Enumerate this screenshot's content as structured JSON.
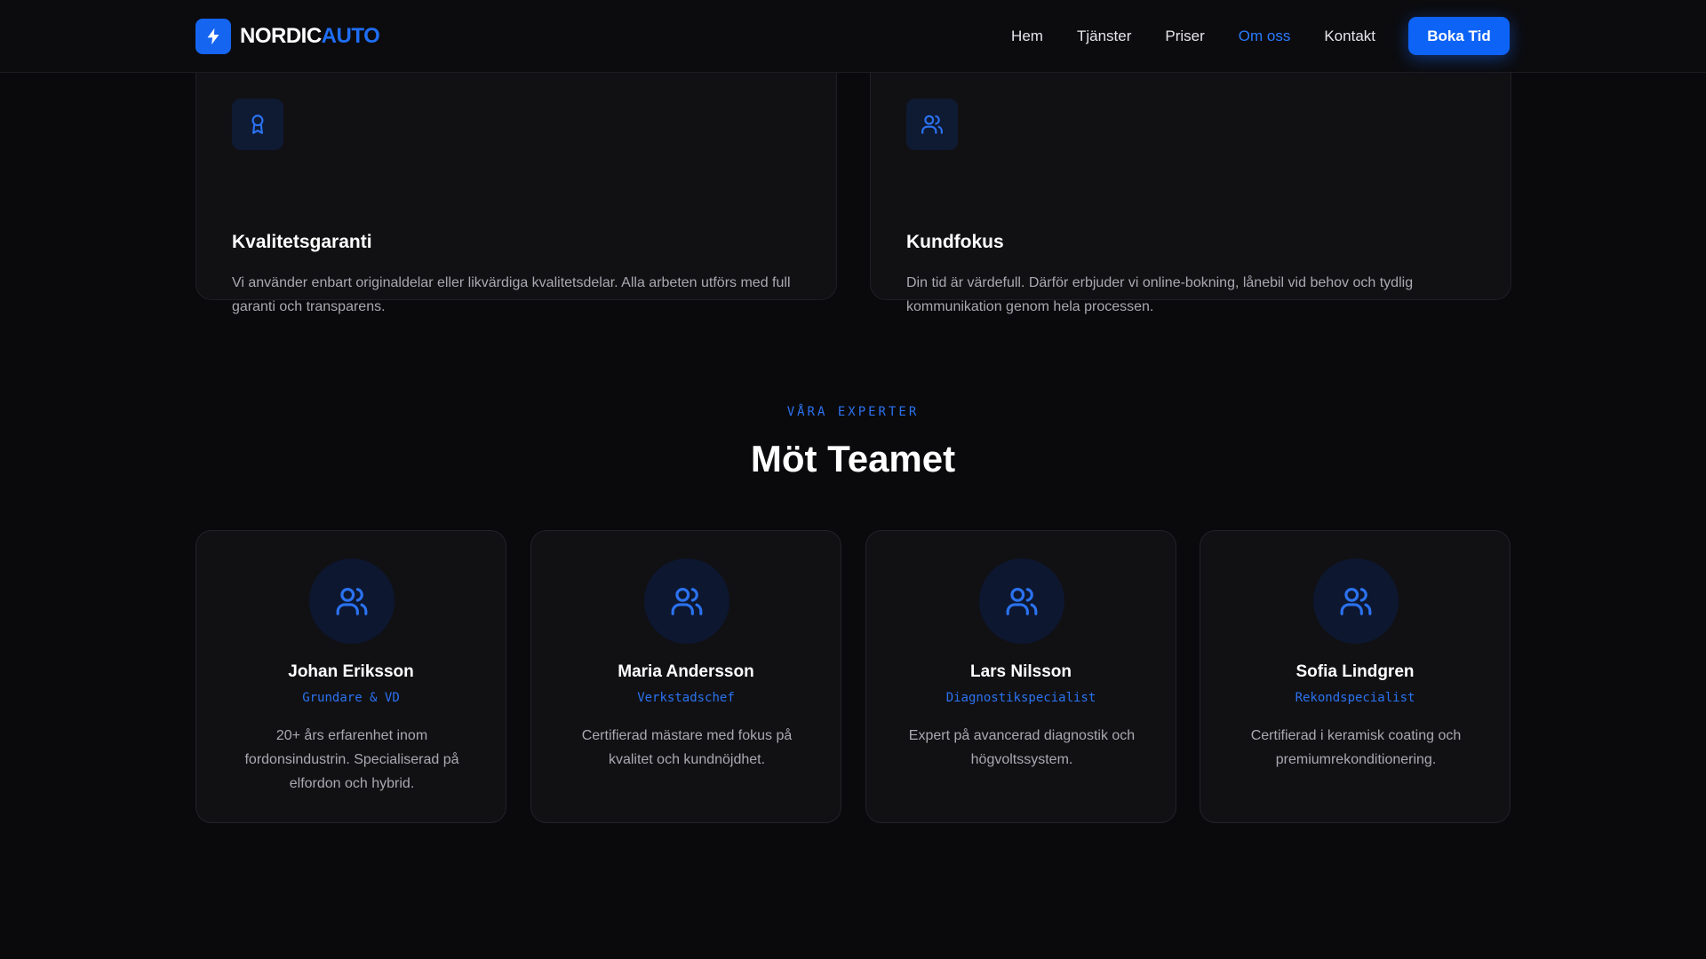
{
  "brand": {
    "name_part1": "NORDIC",
    "name_part2": "AUTO",
    "accent": "#1f6ef5"
  },
  "nav": {
    "links": [
      "Hem",
      "Tjänster",
      "Priser",
      "Om oss",
      "Kontakt"
    ],
    "active": "Om oss",
    "cta_label": "Boka Tid"
  },
  "values": [
    {
      "icon": "award-icon",
      "title": "Kvalitetsgaranti",
      "text": "Vi använder enbart originaldelar eller likvärdiga kvalitetsdelar. Alla arbeten utförs med full garanti och transparens."
    },
    {
      "icon": "users-icon",
      "title": "Kundfokus",
      "text": "Din tid är värdefull. Därför erbjuder vi online-bokning, lånebil vid behov och tydlig kommunikation genom hela processen."
    }
  ],
  "team_section": {
    "eyebrow": "VÅRA EXPERTER",
    "title": "Möt Teamet",
    "members": [
      {
        "name": "Johan Eriksson",
        "role": "Grundare & VD",
        "bio": "20+ års erfarenhet inom fordonsindustrin. Specialiserad på elfordon och hybrid."
      },
      {
        "name": "Maria Andersson",
        "role": "Verkstadschef",
        "bio": "Certifierad mästare med fokus på kvalitet och kundnöjdhet."
      },
      {
        "name": "Lars Nilsson",
        "role": "Diagnostikspecialist",
        "bio": "Expert på avancerad diagnostik och högvoltssystem."
      },
      {
        "name": "Sofia Lindgren",
        "role": "Rekondspecialist",
        "bio": "Certifierad i keramisk coating och premiumrekonditionering."
      }
    ]
  }
}
